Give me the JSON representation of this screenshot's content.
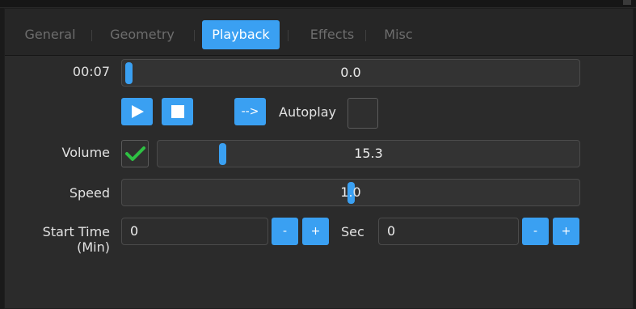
{
  "tabs": [
    {
      "label": "General"
    },
    {
      "label": "Geometry"
    },
    {
      "label": "Playback",
      "active": true
    },
    {
      "label": "Effects"
    },
    {
      "label": "Misc"
    }
  ],
  "playback": {
    "time": "00:07",
    "position_value": "0.0",
    "position_fraction": 0.0,
    "play_icon": "play-icon",
    "stop_icon": "stop-icon",
    "arrow_label": "-->",
    "autoplay_label": "Autoplay",
    "autoplay_checked": false
  },
  "volume": {
    "label": "Volume",
    "enabled": true,
    "value": "15.3",
    "fraction": 0.153
  },
  "speed": {
    "label": "Speed",
    "value": "1.0",
    "fraction": 0.5
  },
  "start_time": {
    "label": "Start Time (Min)",
    "min_value": "0",
    "sec_label": "Sec",
    "sec_value": "0",
    "minus_label": "-",
    "plus_label": "+"
  },
  "colors": {
    "accent": "#3aa0f2",
    "check": "#2ec043"
  }
}
